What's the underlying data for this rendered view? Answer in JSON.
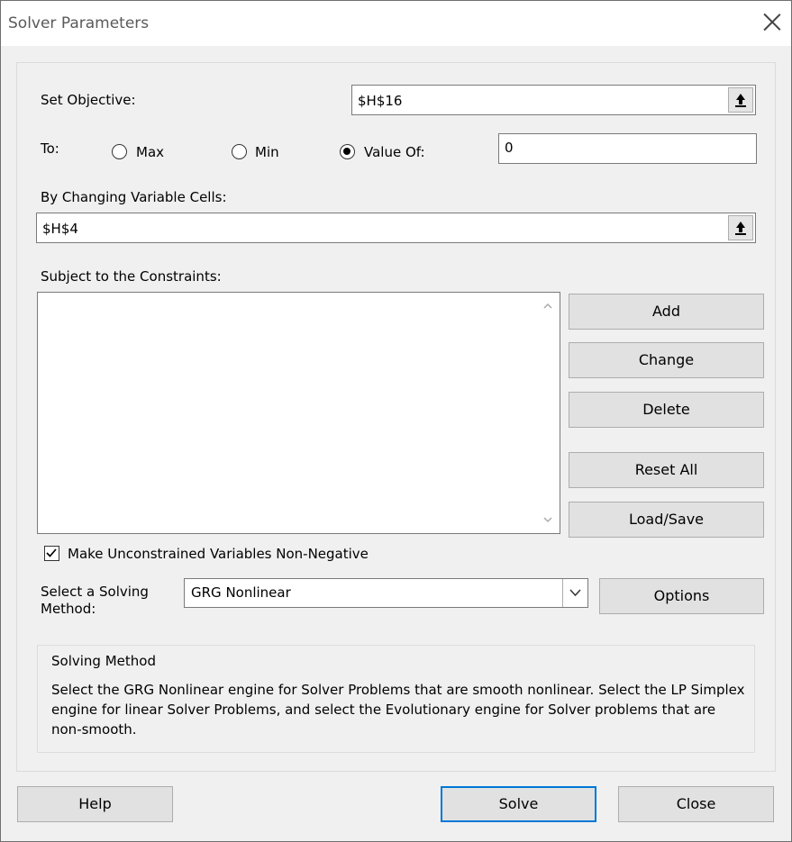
{
  "window": {
    "title": "Solver Parameters"
  },
  "objective": {
    "label": "Set Objective:",
    "value": "$H$16"
  },
  "to": {
    "label": "To:",
    "options": [
      {
        "label": "Max",
        "checked": false
      },
      {
        "label": "Min",
        "checked": false
      },
      {
        "label": "Value Of:",
        "checked": true
      }
    ],
    "value_of": "0"
  },
  "changing": {
    "label": "By Changing Variable Cells:",
    "value": "$H$4"
  },
  "constraints": {
    "label": "Subject to the Constraints:",
    "items": []
  },
  "buttons": {
    "add": "Add",
    "change": "Change",
    "delete": "Delete",
    "reset_all": "Reset All",
    "load_save": "Load/Save",
    "options": "Options",
    "help": "Help",
    "solve": "Solve",
    "close": "Close"
  },
  "nonneg": {
    "label": "Make Unconstrained Variables Non-Negative",
    "checked": true
  },
  "method": {
    "label_line1": "Select a Solving",
    "label_line2": "Method:",
    "selected": "GRG Nonlinear"
  },
  "solving_method": {
    "title": "Solving Method",
    "text": "Select the GRG Nonlinear engine for Solver Problems that are smooth nonlinear. Select the LP Simplex engine for linear Solver Problems, and select the Evolutionary engine for Solver problems that are non-smooth."
  },
  "colors": {
    "accent": "#0078d7",
    "background": "#f0f0f0"
  },
  "icons": {
    "ref_collapse": "collapse-dialog-icon",
    "close": "close-icon",
    "dropdown": "chevron-down-icon"
  }
}
